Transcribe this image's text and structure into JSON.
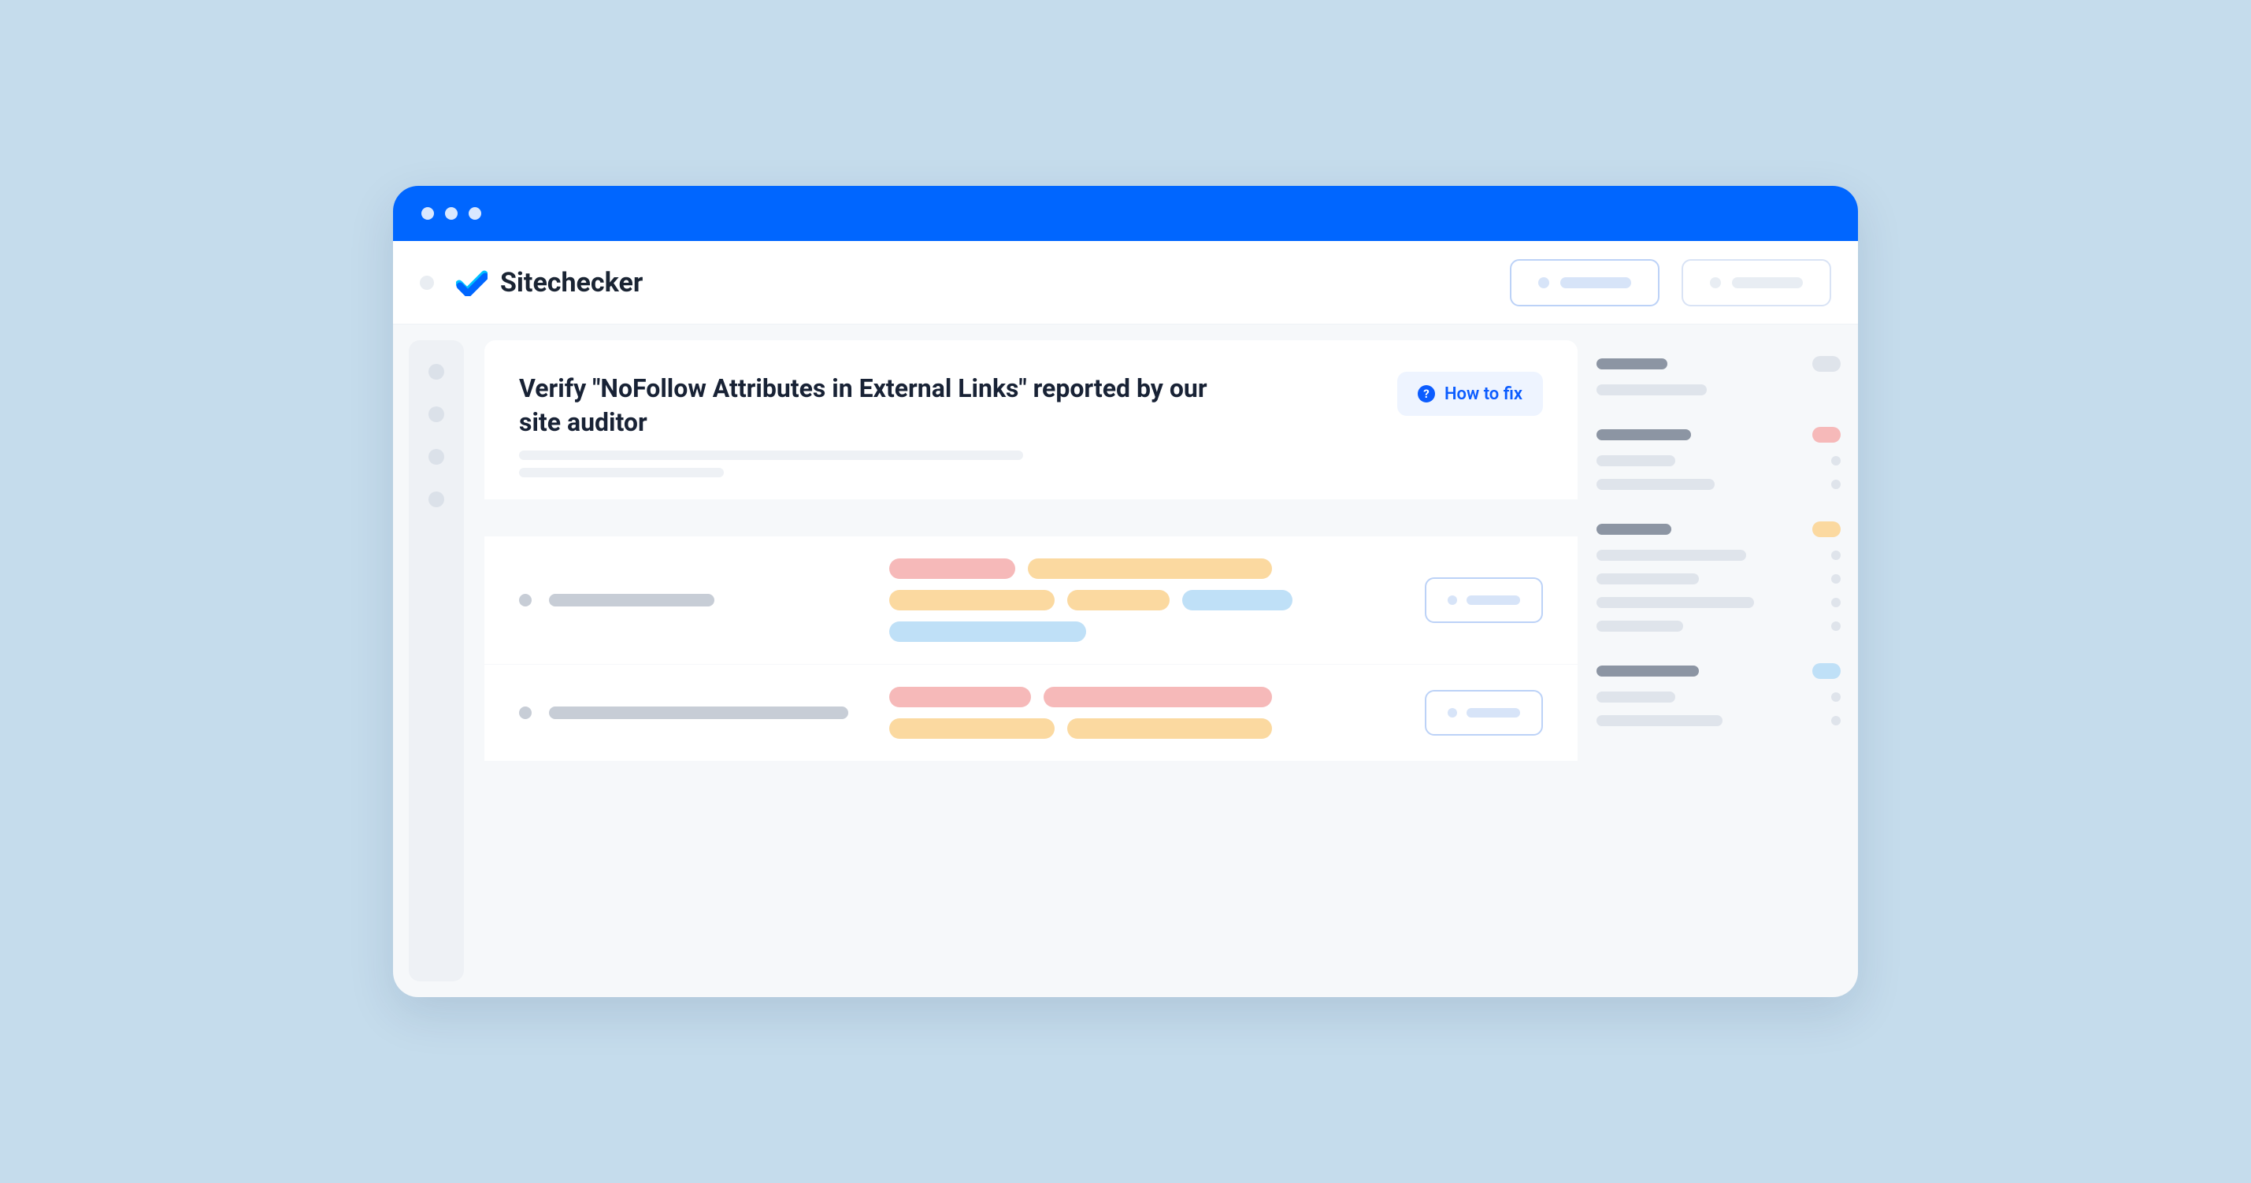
{
  "brand": {
    "name": "Sitechecker"
  },
  "issue": {
    "title": "Verify \"NoFollow Attributes in External Links\" reported by our site auditor",
    "how_to_fix_label": "How to fix"
  },
  "colors": {
    "accent": "#0066ff",
    "red": "#f6b9b9",
    "orange": "#fbd9a0",
    "blue": "#bfe0f7"
  }
}
